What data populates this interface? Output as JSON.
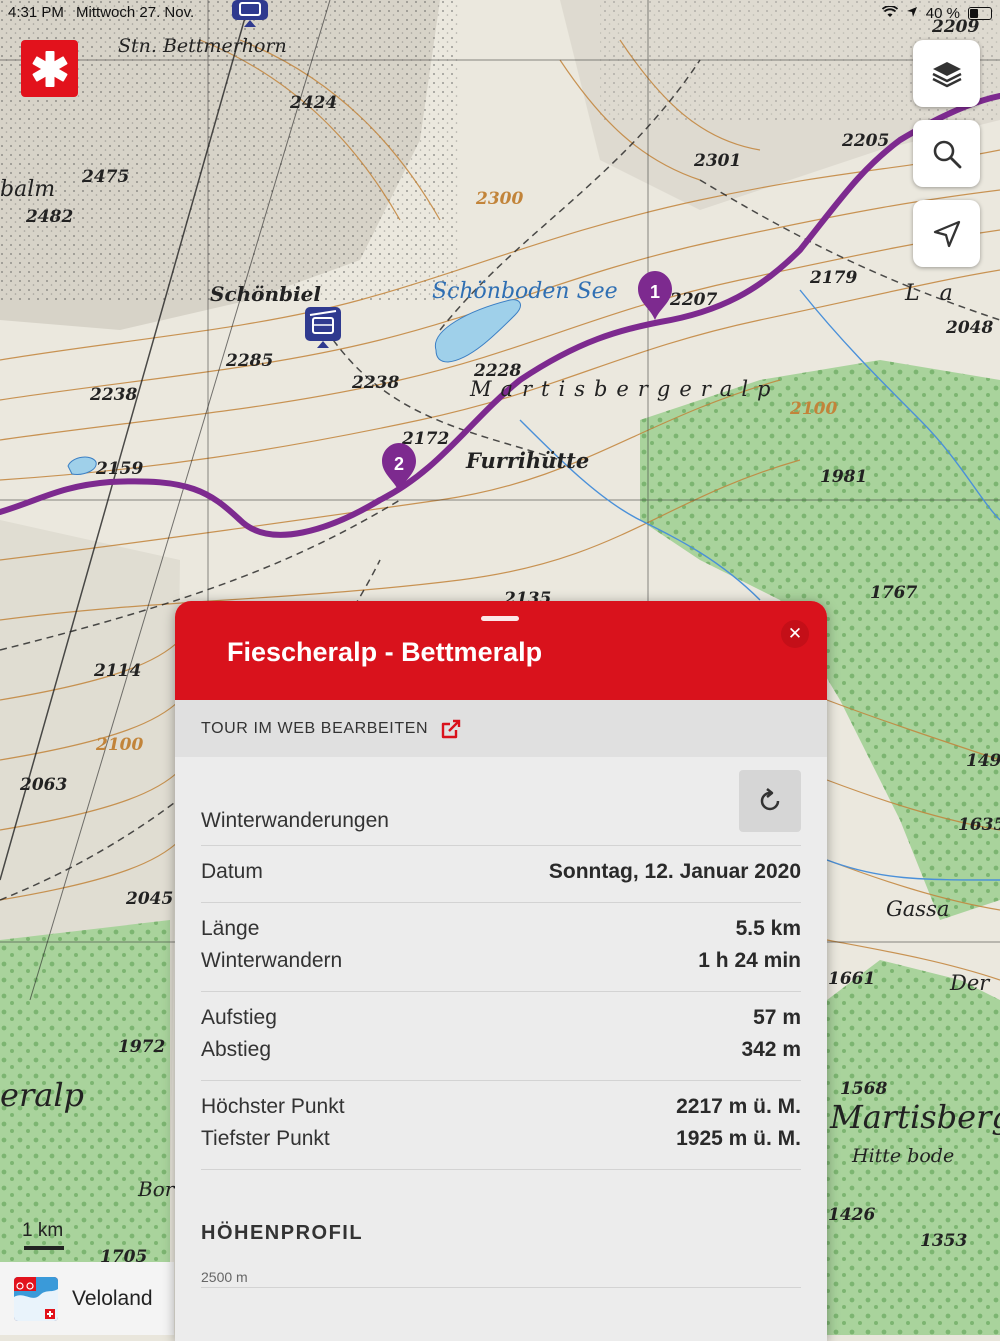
{
  "status_bar": {
    "time": "4:31 PM",
    "date": "Mittwoch 27. Nov.",
    "battery": "40 %"
  },
  "map": {
    "labels": [
      {
        "text": "Stn. Bettmerhorn"
      },
      {
        "text": "Schönbiel"
      },
      {
        "text": "Schönboden See"
      },
      {
        "text": "Martisbergeralp"
      },
      {
        "text": "Furrihütte"
      },
      {
        "text": "Gassa"
      },
      {
        "text": "Martisberg"
      },
      {
        "text": "Hitte bode"
      },
      {
        "text": "eralp"
      },
      {
        "text": "balm"
      },
      {
        "text": "Der"
      },
      {
        "text": "La"
      },
      {
        "text": "Bor"
      }
    ],
    "elevations": [
      "2209",
      "2424",
      "2475",
      "2482",
      "2205",
      "2301",
      "2300",
      "2179",
      "2207",
      "2048",
      "2285",
      "2238",
      "2238",
      "2228",
      "2100",
      "2172",
      "2159",
      "1981",
      "2135",
      "1767",
      "2114",
      "2100",
      "2063",
      "2045",
      "1972",
      "1661",
      "1568",
      "1426",
      "1353",
      "1705",
      "149",
      "1635"
    ],
    "pins": [
      {
        "label": "1"
      },
      {
        "label": "2"
      }
    ],
    "route_color": "#7d2a8f"
  },
  "controls": {
    "layers_icon": "layers-icon",
    "search_icon": "search-icon",
    "locate_icon": "location-arrow-icon"
  },
  "scale": "1 km",
  "panel": {
    "title": "Fiescheralp - Bettmeralp",
    "edit_label": "TOUR IM WEB BEARBEITEN",
    "category": "Winterwanderungen",
    "date_label": "Datum",
    "date_value": "Sonntag, 12. Januar 2020",
    "length_label": "Länge",
    "length_value": "5.5 km",
    "duration_label": "Winterwandern",
    "duration_value": "1 h 24 min",
    "ascent_label": "Aufstieg",
    "ascent_value": "57 m",
    "descent_label": "Abstieg",
    "descent_value": "342 m",
    "highest_label": "Höchster Punkt",
    "highest_value": "2217 m ü. M.",
    "lowest_label": "Tiefster Punkt",
    "lowest_value": "1925 m ü. M.",
    "profile_title": "HÖHENPROFIL",
    "profile_axis": "2500 m"
  },
  "veloland": {
    "label": "Veloland"
  },
  "colors": {
    "accent": "#d9121c",
    "forest": "#8cc481",
    "contour": "#c2843a"
  }
}
